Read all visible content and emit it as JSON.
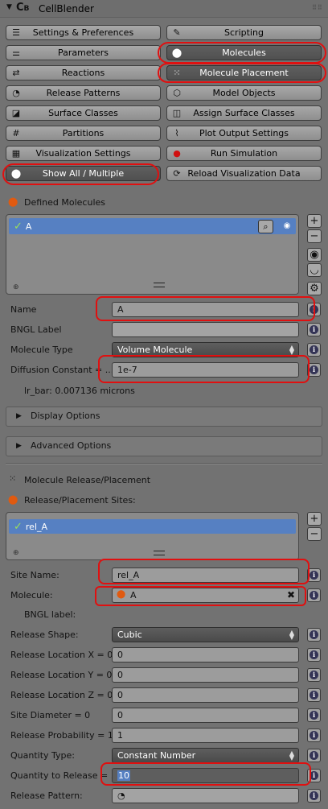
{
  "header": {
    "title": "CellBlender",
    "logo_big": "C",
    "logo_small": "B"
  },
  "buttons": {
    "settings": "Settings & Preferences",
    "scripting": "Scripting",
    "parameters": "Parameters",
    "molecules": "Molecules",
    "reactions": "Reactions",
    "molecule_placement": "Molecule Placement",
    "release_patterns": "Release Patterns",
    "model_objects": "Model Objects",
    "surface_classes": "Surface Classes",
    "assign_surface_classes": "Assign Surface Classes",
    "partitions": "Partitions",
    "plot_output": "Plot Output Settings",
    "visualization": "Visualization Settings",
    "run_simulation": "Run Simulation",
    "show_all": "Show All / Multiple",
    "reload_vis": "Reload Visualization Data"
  },
  "defined_molecules": {
    "section_label": "Defined Molecules",
    "items": [
      {
        "label": "A"
      }
    ],
    "name_label": "Name",
    "name_value": "A",
    "bngl_label": "BNGL Label",
    "bngl_value": "",
    "type_label": "Molecule Type",
    "type_value": "Volume Molecule",
    "diffusion_label": "Diffusion Constant = ...",
    "diffusion_value": "1e-7",
    "lr_bar": "lr_bar:  0.007136  microns",
    "display_options": "Display Options",
    "advanced_options": "Advanced Options"
  },
  "placement": {
    "section_label": "Molecule Release/Placement",
    "sites_label": "Release/Placement Sites:",
    "items": [
      {
        "label": "rel_A"
      }
    ],
    "site_name_label": "Site Name:",
    "site_name_value": "rel_A",
    "molecule_label": "Molecule:",
    "molecule_value": "A",
    "bngl_label": "BNGL label:",
    "shape_label": "Release Shape:",
    "shape_value": "Cubic",
    "loc_x_label": "Release Location X = 0",
    "loc_x_value": "0",
    "loc_y_label": "Release Location Y = 0",
    "loc_y_value": "0",
    "loc_z_label": "Release Location Z = 0",
    "loc_z_value": "0",
    "diameter_label": "Site Diameter = 0",
    "diameter_value": "0",
    "probability_label": "Release Probability = 1",
    "probability_value": "1",
    "quantity_type_label": "Quantity Type:",
    "quantity_type_value": "Constant Number",
    "quantity_label": "Quantity to Release = ...",
    "quantity_value": "10",
    "pattern_label": "Release Pattern:"
  },
  "colors": {
    "highlight_ring": "#e01010",
    "selection": "#5680c2",
    "active_button": "#555555"
  }
}
